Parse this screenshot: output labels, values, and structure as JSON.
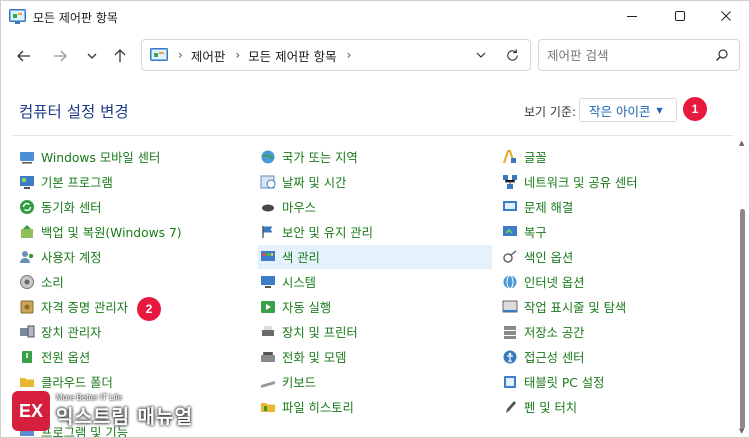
{
  "window": {
    "title": "모든 제어판 항목"
  },
  "nav": {
    "back": "back",
    "forward": "forward",
    "recent": "recent-locations",
    "up": "up"
  },
  "address": {
    "crumbs": [
      "제어판",
      "모든 제어판 항목"
    ]
  },
  "search": {
    "placeholder": "제어판 검색"
  },
  "header": {
    "title": "컴퓨터 설정 변경",
    "view_by_label": "보기 기준:",
    "view_by_value": "작은 아이콘"
  },
  "badges": [
    "1",
    "2"
  ],
  "items": {
    "col1": [
      "Windows 모바일 센터",
      "기본 프로그램",
      "동기화 센터",
      "백업 및 복원(Windows 7)",
      "사용자 계정",
      "소리",
      "자격 증명 관리자",
      "장치 관리자",
      "전원 옵션",
      "클라우드 폴더",
      "",
      "프로그램 및 기능"
    ],
    "col2": [
      "국가 또는 지역",
      "날짜 및 시간",
      "마우스",
      "보안 및 유지 관리",
      "색 관리",
      "시스템",
      "자동 실행",
      "장치 및 프린터",
      "전화 및 모뎀",
      "키보드",
      "파일 히스토리"
    ],
    "col3": [
      "글꼴",
      "네트워크 및 공유 센터",
      "문제 해결",
      "복구",
      "색인 옵션",
      "인터넷 옵션",
      "작업 표시줄 및 탐색",
      "저장소 공간",
      "접근성 센터",
      "태블릿 PC 설정",
      "펜 및 터치"
    ]
  },
  "watermark": {
    "logo": "EX",
    "tagline": "More Better IT Life",
    "name": "익스트림 매뉴얼"
  },
  "colors": {
    "accent": "#1a64b4",
    "item_text": "#1a7a1a",
    "title_text": "#1e3a8a",
    "badge": "#e7193f",
    "highlight": "#e5f1fb"
  }
}
